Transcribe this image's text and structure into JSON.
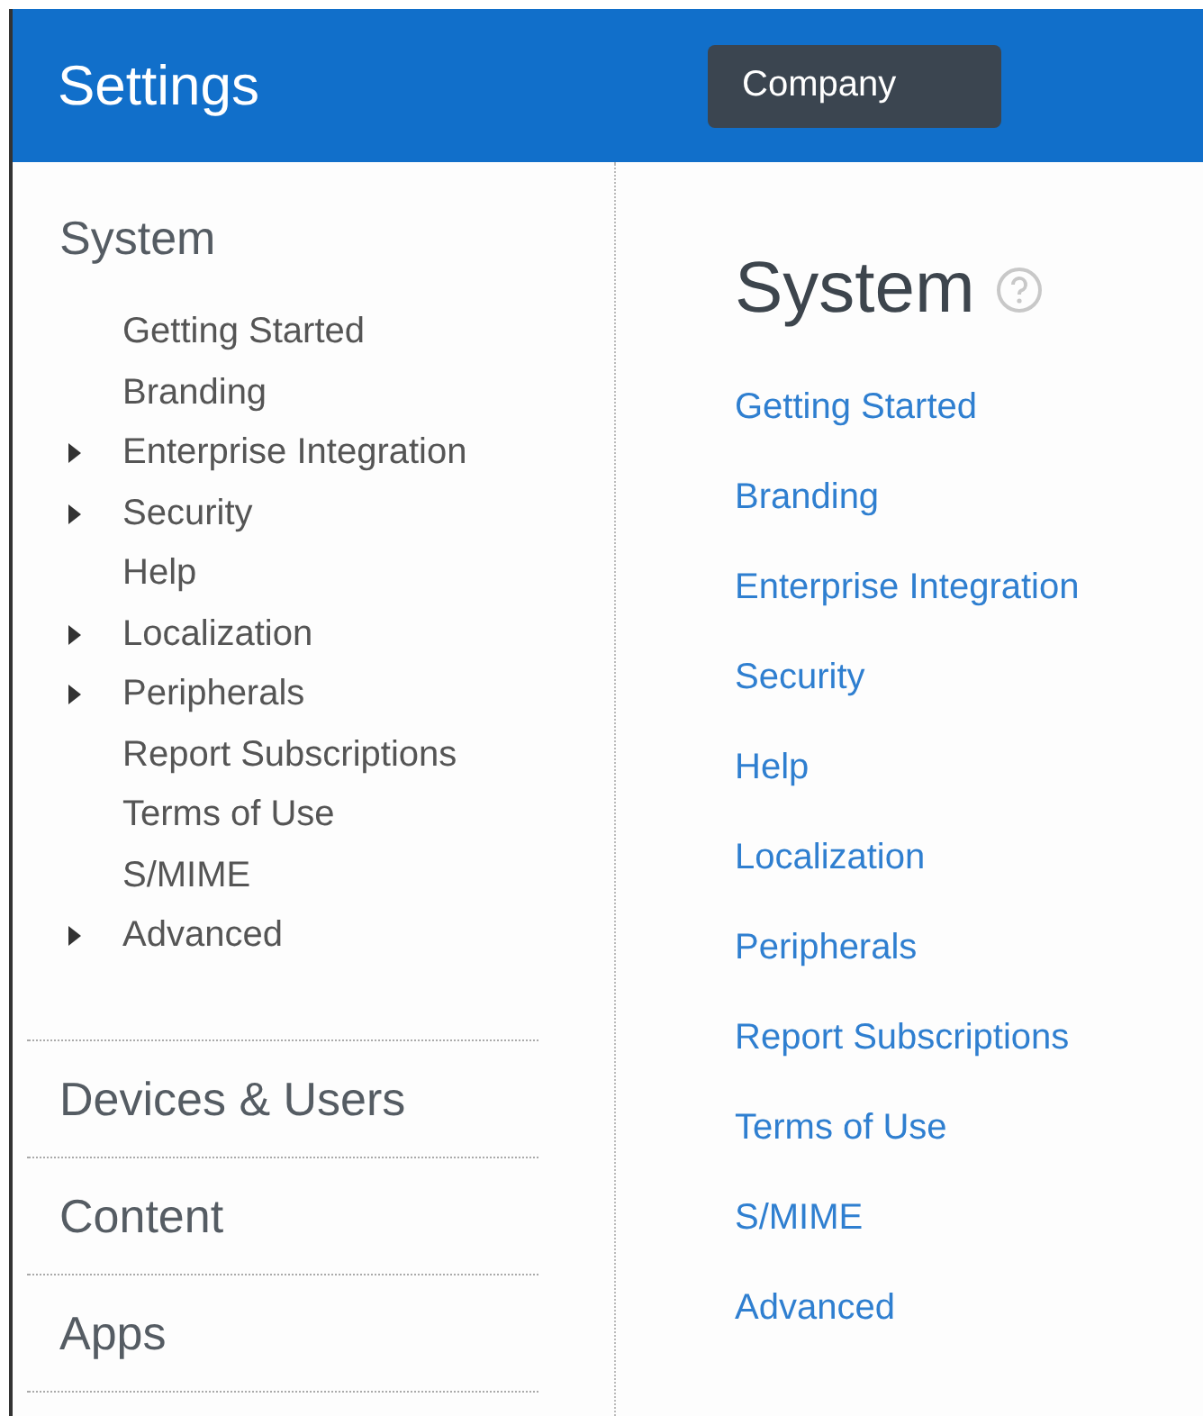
{
  "header": {
    "title": "Settings",
    "company_button": "Company"
  },
  "sidebar": {
    "sections": [
      {
        "title": "System",
        "items": [
          {
            "label": "Getting Started",
            "kind": "leaf"
          },
          {
            "label": "Branding",
            "kind": "leaf"
          },
          {
            "label": "Enterprise Integration",
            "kind": "group"
          },
          {
            "label": "Security",
            "kind": "group"
          },
          {
            "label": "Help",
            "kind": "leaf"
          },
          {
            "label": "Localization",
            "kind": "group"
          },
          {
            "label": "Peripherals",
            "kind": "group"
          },
          {
            "label": "Report Subscriptions",
            "kind": "leaf"
          },
          {
            "label": "Terms of Use",
            "kind": "leaf"
          },
          {
            "label": "S/MIME",
            "kind": "leaf"
          },
          {
            "label": "Advanced",
            "kind": "group"
          }
        ]
      },
      {
        "title": "Devices & Users"
      },
      {
        "title": "Content"
      },
      {
        "title": "Apps"
      }
    ]
  },
  "main": {
    "title": "System",
    "links": [
      "Getting Started",
      "Branding",
      "Enterprise Integration",
      "Security",
      "Help",
      "Localization",
      "Peripherals",
      "Report Subscriptions",
      "Terms of Use",
      "S/MIME",
      "Advanced"
    ]
  }
}
